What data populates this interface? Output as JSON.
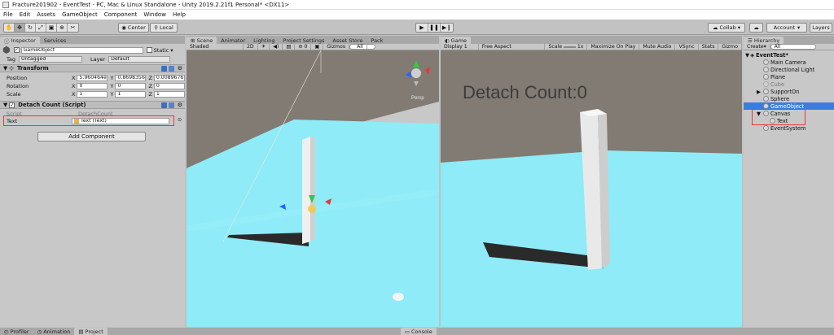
{
  "window": {
    "title": "Fracture201902 - EventTest - PC, Mac & Linux Standalone - Unity 2019.2.21f1 Personal* <DX11>"
  },
  "menu": [
    "File",
    "Edit",
    "Assets",
    "GameObject",
    "Component",
    "Window",
    "Help"
  ],
  "toolbar": {
    "center_label": "Center",
    "local_label": "Local",
    "collab_label": "Collab",
    "account_label": "Account",
    "layers_label": "Layers"
  },
  "inspector": {
    "tabs": [
      "Inspector",
      "Services"
    ],
    "object_name": "GameObject",
    "static_label": "Static",
    "tag_label": "Tag",
    "tag_value": "Untagged",
    "layer_label": "Layer",
    "layer_value": "Default",
    "transform": {
      "title": "Transform",
      "position_label": "Position",
      "rotation_label": "Rotation",
      "scale_label": "Scale",
      "position": {
        "x": "5.960464e",
        "y": "0.8698356",
        "z": "0.0089676"
      },
      "rotation": {
        "x": "0",
        "y": "0",
        "z": "0"
      },
      "scale": {
        "x": "1",
        "y": "1",
        "z": "1"
      }
    },
    "script": {
      "title": "Detach Count (Script)",
      "script_label": "Script",
      "script_value": "DetachCount",
      "text_label": "Text",
      "text_value": "Text (Text)"
    },
    "add_component_label": "Add Component"
  },
  "scene": {
    "tabs": [
      "Scene",
      "Animator",
      "Lighting",
      "Project Settings",
      "Asset Store",
      "Pack"
    ],
    "shading": "Shaded",
    "mode_2d": "2D",
    "gizmos_label": "Gizmos",
    "search_placeholder": "All",
    "persp_label": "Persp"
  },
  "game": {
    "tab": "Game",
    "display": "Display 1",
    "aspect": "Free Aspect",
    "scale_label": "Scale",
    "scale_value": "1x",
    "buttons": [
      "Maximize On Play",
      "Mute Audio",
      "VSync",
      "Stats",
      "Gizmo"
    ],
    "ui_text": "Detach Count:0"
  },
  "hierarchy": {
    "tab": "Hierarchy",
    "create_label": "Create",
    "search_placeholder": "All",
    "scene_name": "EventTest*",
    "items": [
      {
        "label": "Main Camera"
      },
      {
        "label": "Directional Light"
      },
      {
        "label": "Plane"
      },
      {
        "label": "Cube"
      },
      {
        "label": "SupportOn"
      },
      {
        "label": "Sphere"
      },
      {
        "label": "GameObject"
      },
      {
        "label": "Canvas"
      },
      {
        "label": "Text"
      },
      {
        "label": "EventSystem"
      }
    ]
  },
  "bottom": {
    "tabs": [
      "Profiler",
      "Animation",
      "Project",
      "Console"
    ]
  },
  "colors": {
    "selection": "#3b7ddc",
    "highlight_box": "#e53935",
    "plane": "#8eebf7",
    "sky": "#817b73",
    "game_text": "#3c3c3c"
  }
}
